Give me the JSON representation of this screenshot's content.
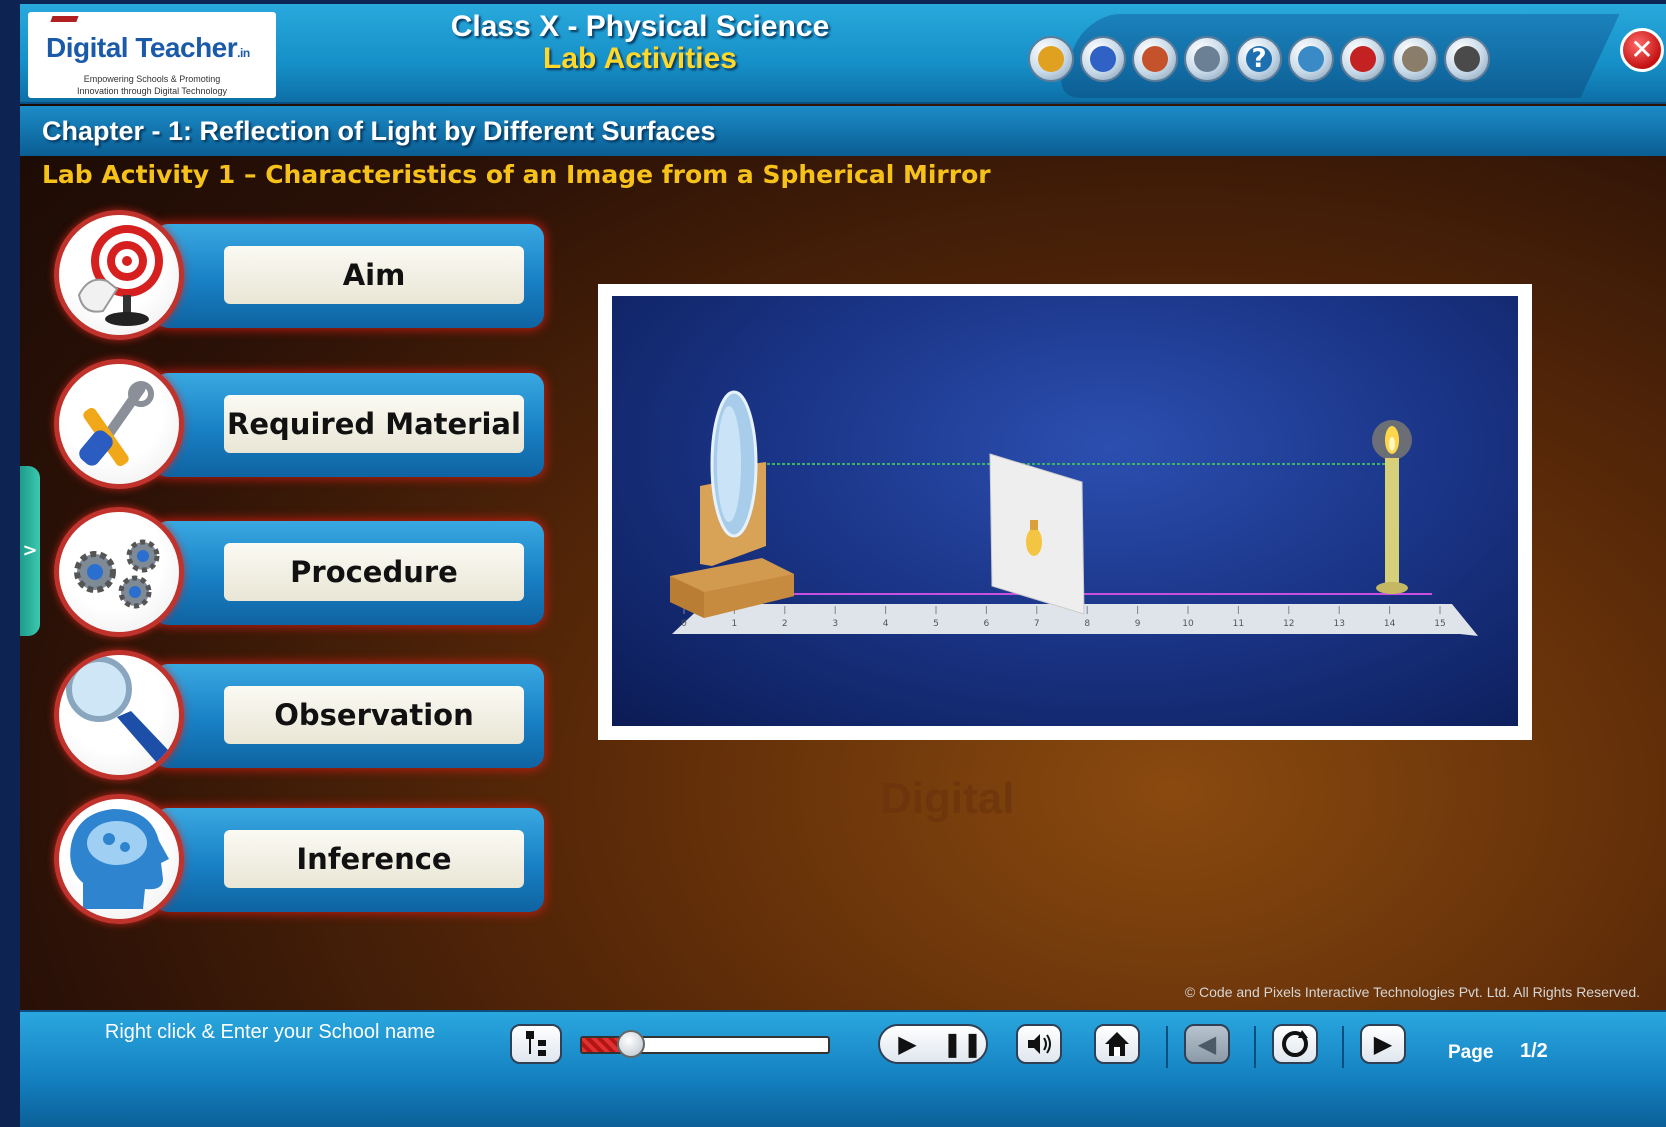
{
  "logo": {
    "brand_main": "Digital Teacher",
    "brand_suffix": ".in",
    "tagline1": "Empowering Schools & Promoting",
    "tagline2": "Innovation through Digital Technology"
  },
  "header": {
    "title": "Class X - Physical Science",
    "subtitle": "Lab Activities",
    "toolbar_icons": [
      "gallery-icon",
      "notebook-icon",
      "eraser-icon",
      "notes-icon",
      "help-icon",
      "search-icon",
      "book-icon",
      "glossary-icon",
      "resize-icon"
    ],
    "close_symbol": "✕"
  },
  "chapter": {
    "title": "Chapter - 1: Reflection of Light by Different Surfaces",
    "activity": "Lab Activity 1 – Characteristics of an Image from a Spherical Mirror"
  },
  "menu": [
    {
      "label": "Aim",
      "icon": "target-icon"
    },
    {
      "label": "Required Material",
      "icon": "tools-icon"
    },
    {
      "label": "Procedure",
      "icon": "gears-icon"
    },
    {
      "label": "Observation",
      "icon": "magnifier-icon"
    },
    {
      "label": "Inference",
      "icon": "brain-icon"
    }
  ],
  "lab": {
    "scale_ticks": [
      "0",
      "1",
      "2",
      "3",
      "4",
      "5",
      "6",
      "7",
      "8",
      "9",
      "10",
      "11",
      "12",
      "13",
      "14",
      "15"
    ]
  },
  "watermark": "Digital",
  "copyright": "© Code and Pixels Interactive Technologies Pvt. Ltd. All Rights Reserved.",
  "side_tab": ">",
  "footer": {
    "school_text": "Right click & Enter your School name",
    "progress_fraction": 0.2,
    "page_label": "Page",
    "page_value": "1/2",
    "play_symbol": "▶",
    "pause_symbol": "❚❚",
    "prev_symbol": "◀",
    "next_symbol": "▶"
  },
  "colors": {
    "header_blue": "#1690c8",
    "title_yellow": "#ffd82a",
    "activity_gold": "#f6c21a",
    "menu_glow": "#c0322c"
  }
}
